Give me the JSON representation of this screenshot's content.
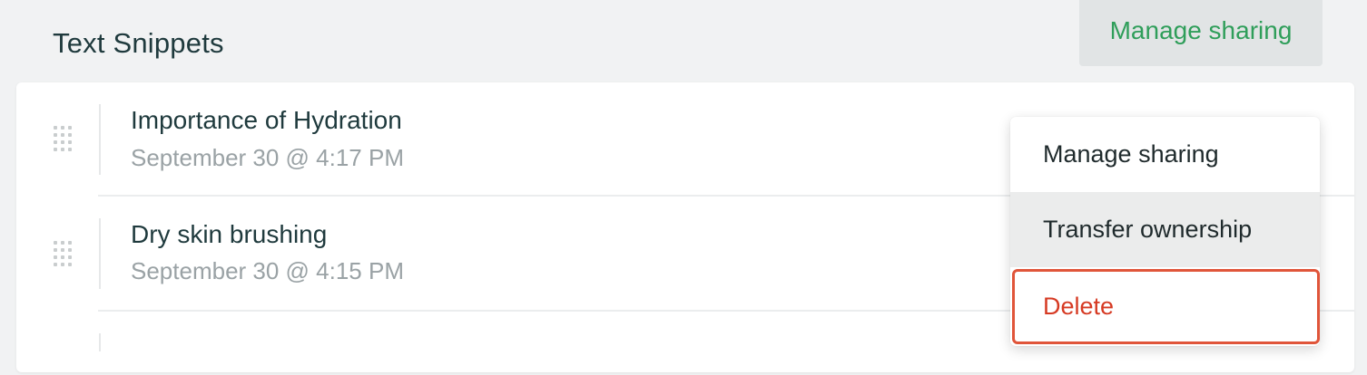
{
  "section": {
    "title": "Text Snippets"
  },
  "header": {
    "manage_sharing_label": "Manage sharing"
  },
  "snippets": [
    {
      "title": "Importance of Hydration",
      "date": "September 30 @ 4:17 PM"
    },
    {
      "title": "Dry skin brushing",
      "date": "September 30 @ 4:15 PM"
    }
  ],
  "context_menu": {
    "items": [
      {
        "label": "Manage sharing"
      },
      {
        "label": "Transfer ownership"
      },
      {
        "label": "Delete"
      }
    ]
  },
  "colors": {
    "accent_green": "#2f9e5a",
    "danger_red": "#d63a23",
    "title_text": "#1f3a3d",
    "muted_text": "#9aa2a5"
  },
  "icons": {
    "drag_handle": "drag-handle-icon"
  }
}
